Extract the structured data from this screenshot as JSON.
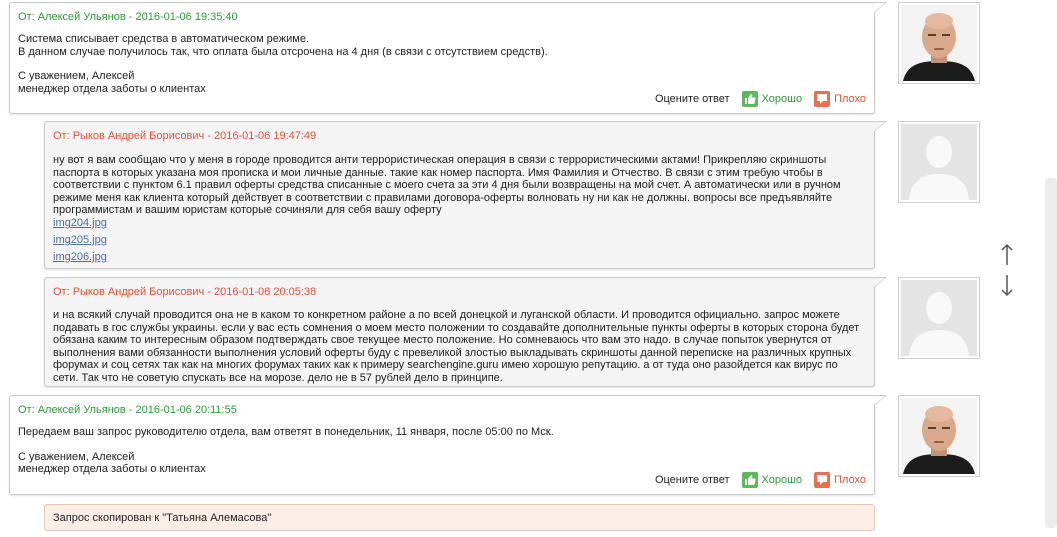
{
  "messages": [
    {
      "author": "От: Алексей Ульянов - 2016-01-06 19:35:40",
      "lines_a": [
        "Система списывает средства в автоматическом режиме.",
        "В данном случае получилось так, что оплата была отсрочена на 4 дня (в связи с отсутствием средств)."
      ],
      "lines_b": [
        "С уважением, Алексей",
        "менеджер отдела заботы о клиентах"
      ]
    },
    {
      "author": "От: Рыков Андрей Борисович - 2016-01-06 19:47:49",
      "lines": [
        "ну вот я вам сообщаю что у меня в городе проводится анти террористическая операция в связи с террористическими актами! Прикрепляю скриншоты",
        "паспорта в которых указана моя прописка и мои личные данные. такие как номер паспорта. Имя Фамилия и Отчество. В связи с этим требую чтобы в",
        "соответствии с пунктом 6.1 правил оферты средства списанные с моего счета за эти 4 дня были возвращены на мой счет. А автоматически или в ручном",
        "режиме меня как клиента который действует в соответствии с правилами договора-оферты волновать ну ни как не должны. вопросы все предъявляйте",
        "программистам и вашим юристам которые сочиняли для себя вашу оферту"
      ],
      "attachments": [
        "img204.jpg",
        "img205.jpg",
        "img206.jpg"
      ]
    },
    {
      "author": "От: Рыков Андрей Борисович - 2016-01-06 20:05:38",
      "lines": [
        "и на всякий случай проводится она не в каком то конкретном районе а по всей донецкой и луганской области. И проводится официально. запрос можете",
        "подавать в гос службы украины. если у вас есть сомнения о моем место положении то создавайте дополнительные пункты оферты в которых сторона будет",
        "обязана каким то интересным образом подтверждать свое текущее место положение. Но сомневаюсь что вам это надо. в случае попыток увернутся от",
        "выполнения вами обязанности выполнения условий оферты буду с превеликой злостью выкладывать скриншоты данной переписке на различных крупных",
        "форумах и соц сетях так как на многих форумах таких как к примеру searchengine.guru имею хорошую репутацию. а от туда оно разойдется как вирус по",
        "сети. Так что не советую спускать все на морозе. дело не в 57 рублей дело в принципе."
      ]
    },
    {
      "author": "От: Алексей Ульянов - 2016-01-06 20:11:55",
      "lines_a": [
        "Передаем ваш запрос руководителю отдела, вам ответят в понедельник, 11 января, после 05:00 по Мск."
      ],
      "lines_b": [
        "С уважением, Алексей",
        "менеджер отдела заботы о клиентах"
      ]
    }
  ],
  "rating": {
    "label": "Оцените ответ",
    "good": "Хорошо",
    "bad": "Плохо"
  },
  "note": "Запрос скопирован к \"Татьяна Алемасова\"",
  "colors": {
    "support_header": "#2f9a3c",
    "user_header": "#dd5236",
    "link": "#4b6f99"
  },
  "icons": {
    "good": "thumbs-up-icon",
    "bad": "thumbs-down-icon",
    "scroll": "up-down-arrows-icon"
  }
}
